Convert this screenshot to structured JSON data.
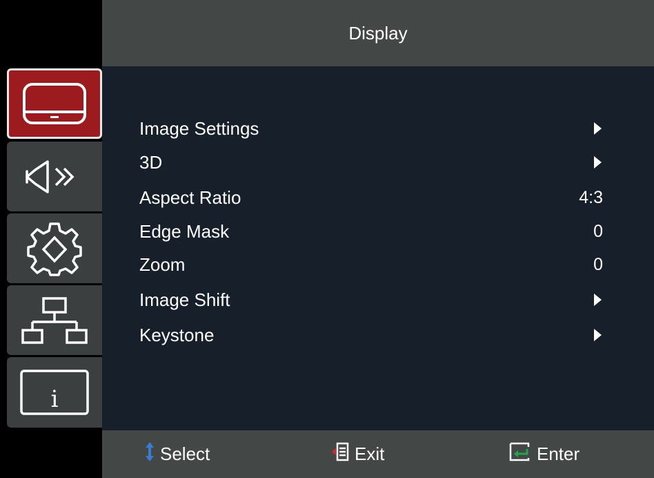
{
  "header": {
    "title": "Display"
  },
  "sidebar": {
    "items": [
      {
        "id": "display",
        "icon": "display-icon",
        "active": true
      },
      {
        "id": "audio",
        "icon": "speaker-icon",
        "active": false
      },
      {
        "id": "setup",
        "icon": "gear-icon",
        "active": false
      },
      {
        "id": "network",
        "icon": "network-icon",
        "active": false
      },
      {
        "id": "info",
        "icon": "info-icon",
        "active": false
      }
    ]
  },
  "menu": {
    "items": [
      {
        "label": "Image Settings",
        "value": null,
        "icon": "arrow-right-icon"
      },
      {
        "label": "3D",
        "value": null,
        "icon": "arrow-right-icon"
      },
      {
        "label": "Aspect Ratio",
        "value": "4:3"
      },
      {
        "label": "Edge Mask",
        "value": "0"
      },
      {
        "label": "Zoom",
        "value": "0"
      },
      {
        "label": "Image Shift",
        "value": null,
        "icon": "arrow-right-icon"
      },
      {
        "label": "Keystone",
        "value": null,
        "icon": "arrow-right-icon"
      }
    ]
  },
  "footer": {
    "select_label": "Select",
    "exit_label": "Exit",
    "enter_label": "Enter"
  },
  "colors": {
    "active_tab": "#9c1b1f",
    "header_bg": "#434847",
    "panel_bg": "#17202a",
    "select_arrow": "#3a7bd5",
    "exit_arrow": "#e0242b",
    "enter_arrow": "#1fa84a"
  }
}
